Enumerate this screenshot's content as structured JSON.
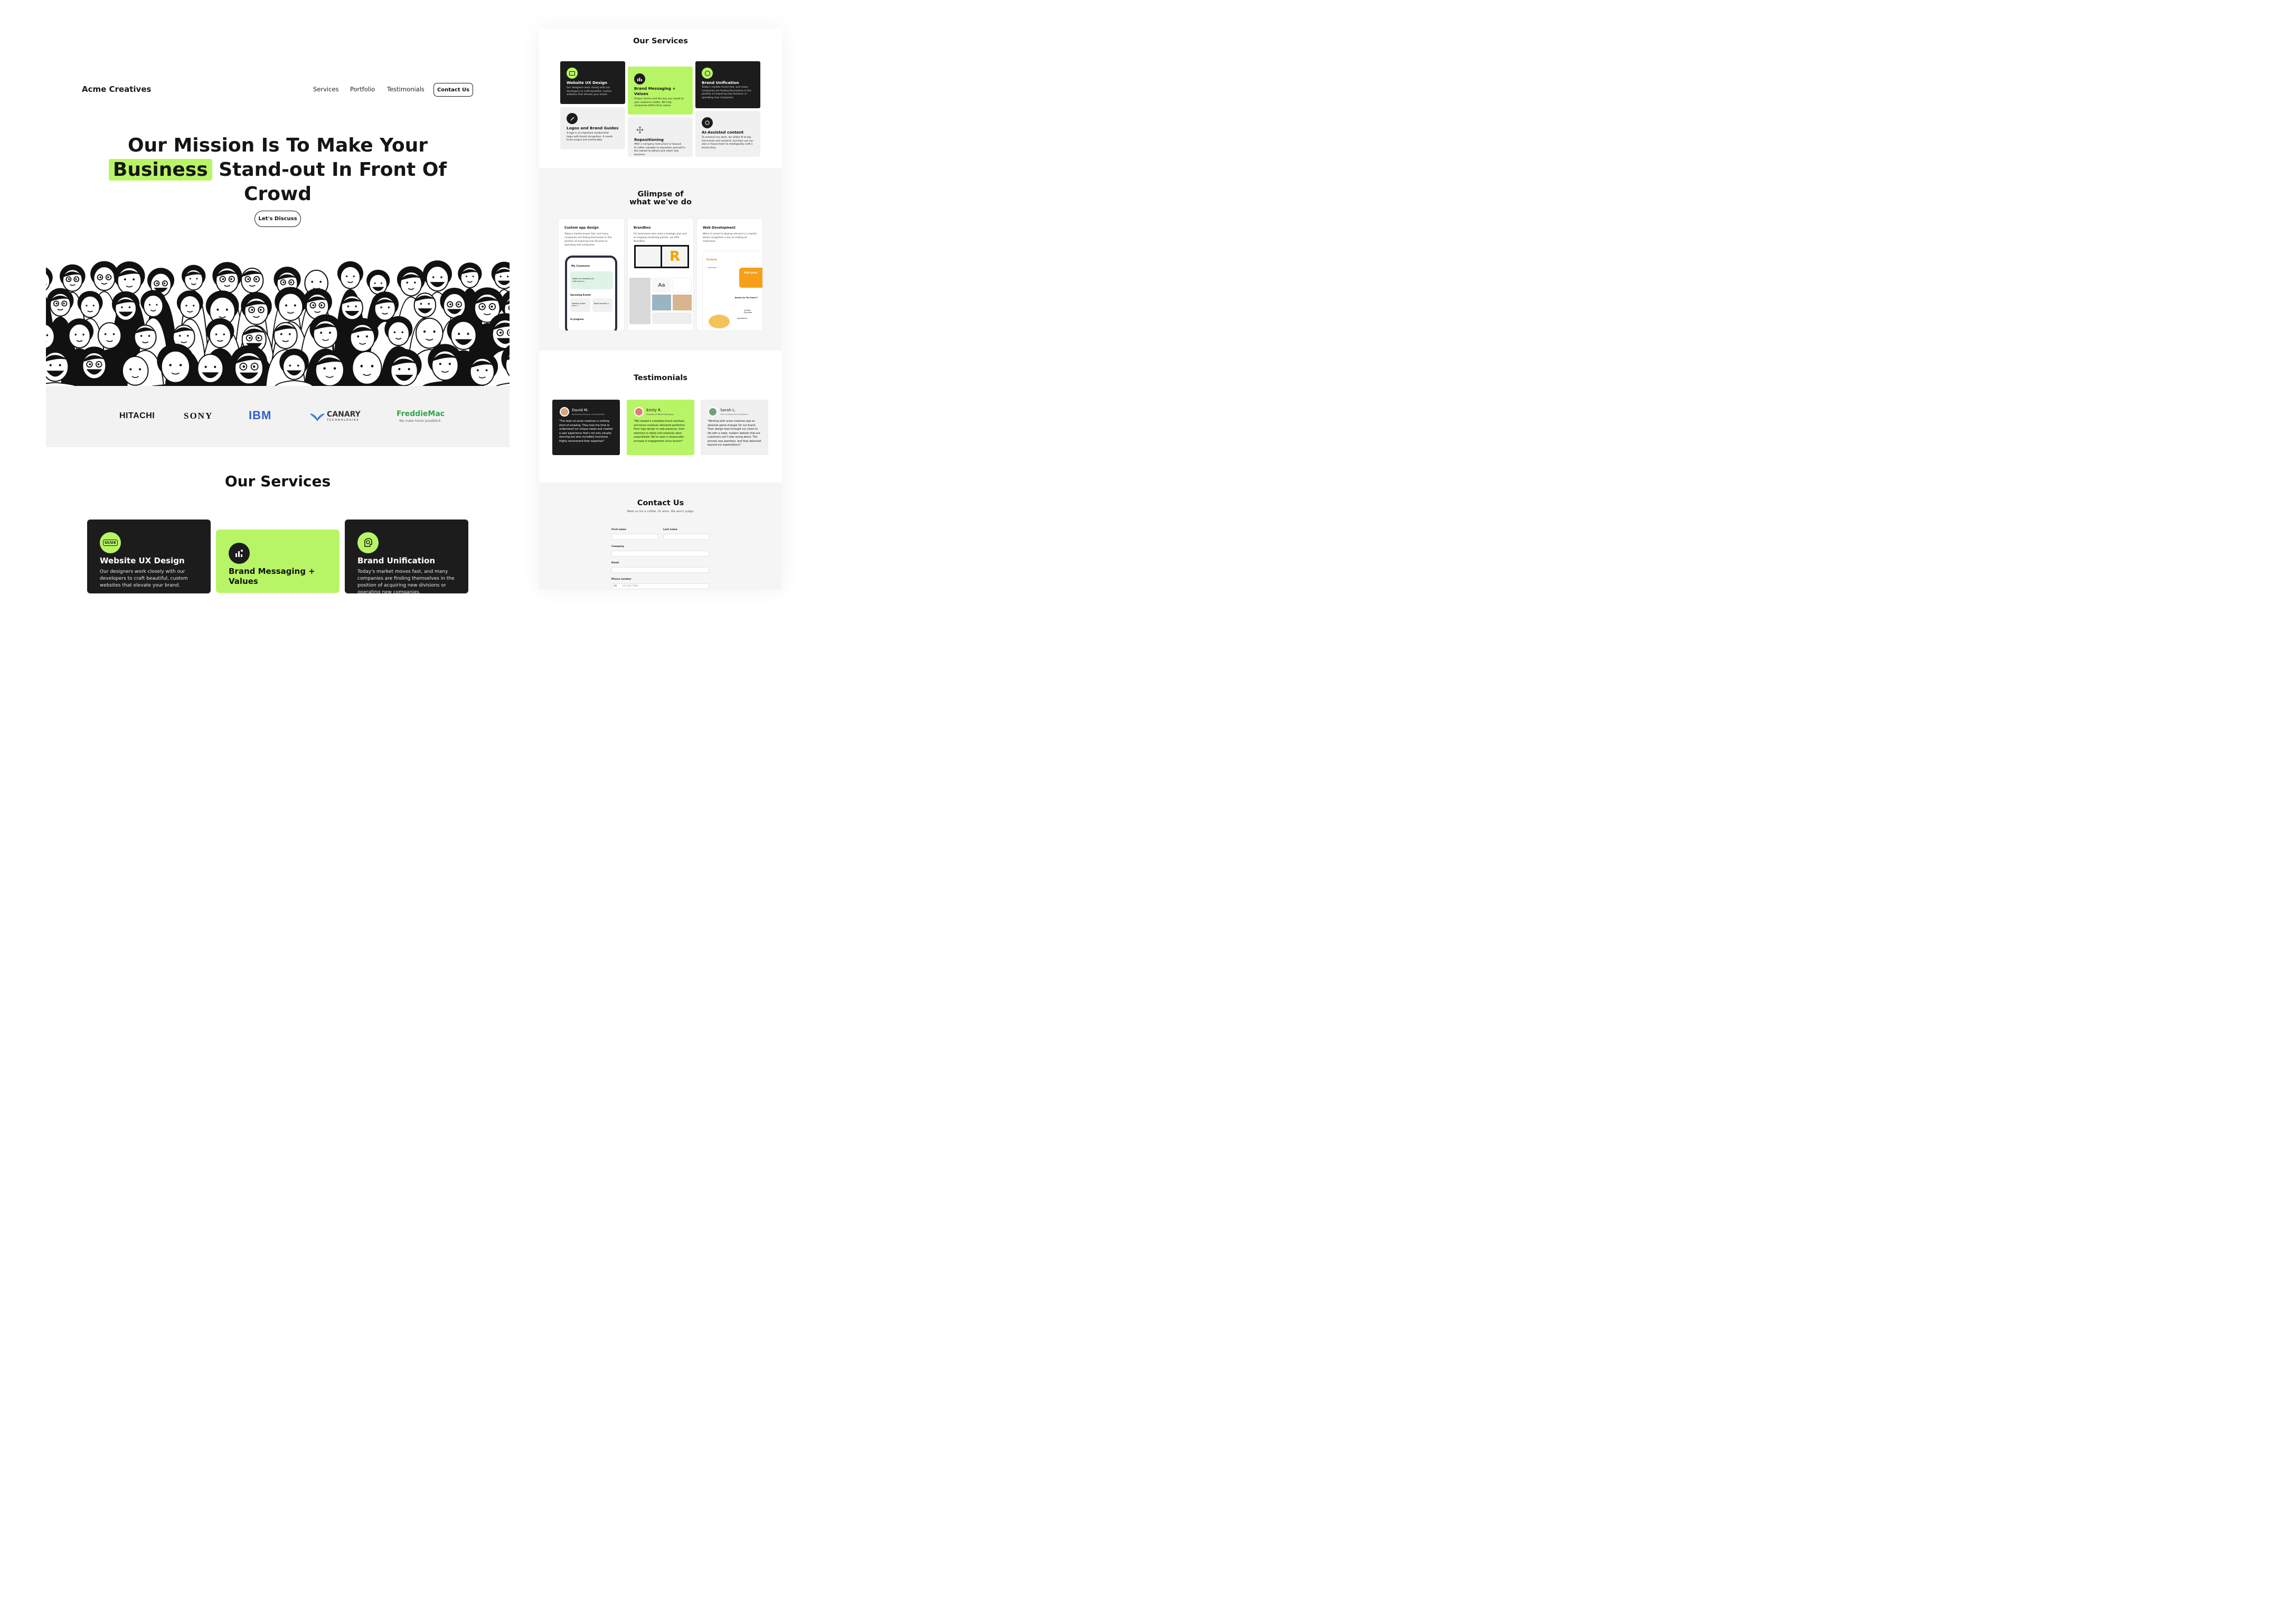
{
  "colors": {
    "accent": "#b8f566",
    "dark": "#1c1c1c",
    "light": "#f2f2f2"
  },
  "header": {
    "brand": "Acme Creatives",
    "nav": [
      "Services",
      "Portfolio",
      "Testimonials"
    ],
    "contact": "Contact Us"
  },
  "hero": {
    "line1": "Our Mission Is To Make Your",
    "highlight": "Business",
    "line2": "Stand-out In Front Of",
    "line3": "Crowd",
    "cta": "Let's Discuss"
  },
  "logos": {
    "hitachi": "HITACHI",
    "sony": "SONY",
    "ibm": "IBM",
    "canary": "CANARY",
    "canary_sub": "TECHNOLOGIES",
    "freddie": "FreddieMac",
    "freddie_sub": "We make home possible®"
  },
  "services": {
    "title": "Our Services",
    "items": [
      {
        "title": "Website UX Design",
        "desc": "Our designers work closely with our developers to craft beautiful, custom websites that elevate your brand.",
        "icon": "ui-ux-icon",
        "badge": "UI/UX"
      },
      {
        "title": "Brand Messaging + Values",
        "desc": "Unique stories and the way you speak to your audience matter. We help companies define their values.",
        "icon": "chart-person-icon"
      },
      {
        "title": "Brand Unification",
        "desc": "Today's market moves fast, and many companies are finding themselves in the position of acquiring new divisions or operating new companies.",
        "icon": "head-gear-icon"
      },
      {
        "title": "Logos and Brand Guides",
        "desc": "A logo is an important symbol that helps with brand recognition. It needs to be unique and memorable.",
        "icon": "pen-icon"
      },
      {
        "title": "Repositioning",
        "desc": "After a company restructure or buyout, it's often valuable to reposition yourself in the market to attract and retain new business.",
        "icon": "move-icon"
      },
      {
        "title": "AI-Assisted content",
        "desc": "To enhance our work, we utilize AI to tap into trends and research, but then use our own in-house team to strategically craft a brand story.",
        "icon": "ai-icon"
      }
    ]
  },
  "glimpse": {
    "title_line1": "Glimpse of",
    "title_line2": "what we've do",
    "items": [
      {
        "title": "Custom app design",
        "desc": "Today's market moves fast, and many companies are finding themselves in the position of acquiring new divisions or operating new companies."
      },
      {
        "title": "Brandbox",
        "desc": "For businesses who need a strategic plan and an ongoing marketing partner, we offer Brandbox."
      },
      {
        "title": "Web Development",
        "desc": "When it comes to staying relevant in a market where recognition is key to making an impression."
      }
    ],
    "app": {
      "header": "My Commune",
      "event": "Watch for Reading On 14th and m...",
      "upcoming": "Upcoming Events",
      "e1": "Meeting of New year c...",
      "e2": "Blood donation C...",
      "progress": "In progress"
    },
    "brand": {
      "aa": "Aa",
      "mark": "R"
    },
    "web": {
      "brand": "Recipely",
      "overview": "Overview",
      "add": "Add your",
      "based": "Based On The Food Y",
      "scallion": "Scallion Pancakes",
      "ingredients": "Ingredients"
    }
  },
  "testimonials": {
    "title": "Testimonials",
    "items": [
      {
        "name": "David M.",
        "role": "Marketing Director at UrbanGear",
        "quote": "\"The team at acme creatives is nothing short of amazing. They took the time to understand our unique needs and created a user experience that's not only visually stunning but also incredibly functional. Highly recommend their expertise!\""
      },
      {
        "name": "Emily R.",
        "role": "Founder of Bloom Boutique",
        "quote": "\"We needed a complete brand overhaul, and Acme creatives delivered perfection. From logo design to web presence, their attention to detail and creativity were unparalleled. We've seen a measurable increase in engagement since launch!\""
      },
      {
        "name": "Sarah L.",
        "role": "CEO of GreenTech Solutions",
        "quote": "\"Working with acme creatives was an absolute game-changer for our brand. Their design team brought our vision to life with a sleek, modern website that our customers can't stop raving about. The process was seamless, and they delivered beyond our expectations!\""
      }
    ]
  },
  "contact": {
    "title": "Contact Us",
    "subtitle": "Meet us for a coffee. Or wine. We won't judge.",
    "first": "First name",
    "last": "Last name",
    "company": "Company",
    "email": "Email",
    "phone": "Phone number",
    "country": "US",
    "phone_placeholder": "123-456-7890"
  }
}
